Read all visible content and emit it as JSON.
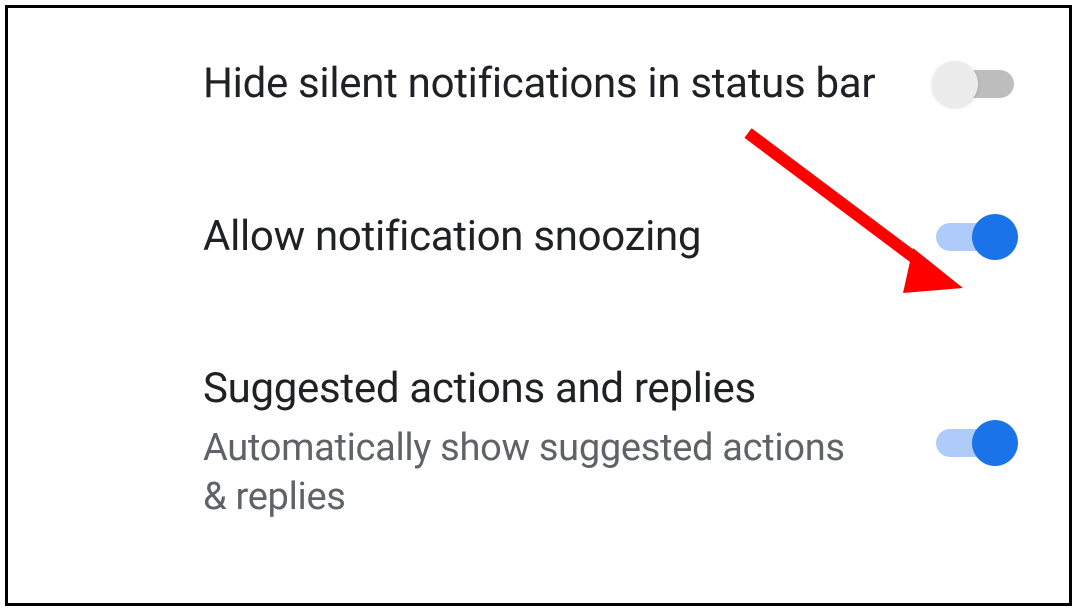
{
  "settings": [
    {
      "title": "Hide silent notifications in status bar",
      "subtitle": null,
      "enabled": false
    },
    {
      "title": "Allow notification snoozing",
      "subtitle": null,
      "enabled": true
    },
    {
      "title": "Suggested actions and replies",
      "subtitle": "Automatically show suggested actions & replies",
      "enabled": true
    }
  ],
  "annotation": {
    "arrow_color": "#ff0000",
    "target": "allow-snoozing-toggle"
  }
}
